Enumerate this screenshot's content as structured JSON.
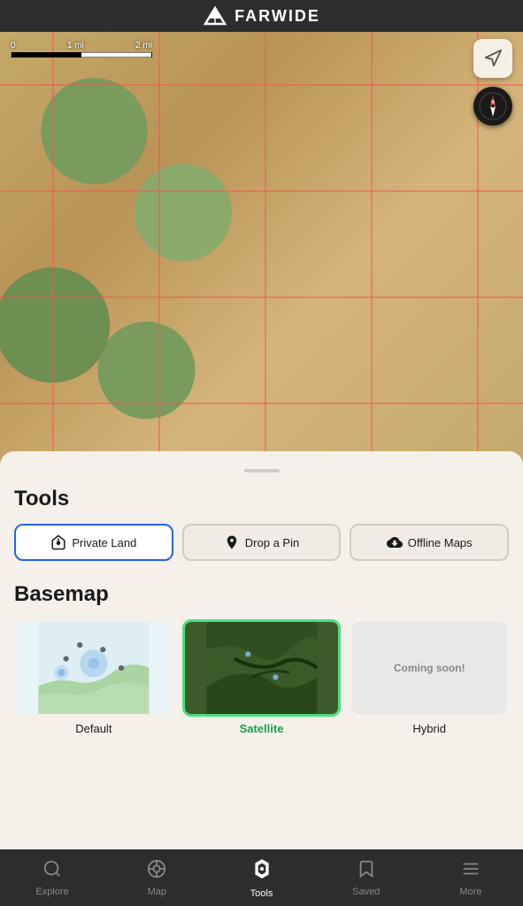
{
  "app": {
    "name": "FARWIDE"
  },
  "map": {
    "scale": {
      "label0": "0",
      "label1": "1 mi",
      "label2": "2 mi"
    }
  },
  "tools_section": {
    "title": "Tools",
    "buttons": [
      {
        "id": "private-land",
        "label": "Private Land",
        "active": true
      },
      {
        "id": "drop-a-pin",
        "label": "Drop a Pin",
        "active": false
      },
      {
        "id": "offline-maps",
        "label": "Offline Maps",
        "active": false
      }
    ]
  },
  "basemap_section": {
    "title": "Basemap",
    "items": [
      {
        "id": "default",
        "label": "Default",
        "selected": false
      },
      {
        "id": "satellite",
        "label": "Satellite",
        "selected": true
      },
      {
        "id": "hybrid",
        "label": "Hybrid",
        "selected": false,
        "coming_soon": "Coming soon!"
      }
    ]
  },
  "bottom_nav": {
    "items": [
      {
        "id": "explore",
        "label": "Explore",
        "active": false,
        "icon": "🔍"
      },
      {
        "id": "map",
        "label": "Map",
        "active": false,
        "icon": "◎"
      },
      {
        "id": "tools",
        "label": "Tools",
        "active": true,
        "icon": "⬡"
      },
      {
        "id": "saved",
        "label": "Saved",
        "active": false,
        "icon": "🔖"
      },
      {
        "id": "more",
        "label": "More",
        "active": false,
        "icon": "☰"
      }
    ]
  }
}
